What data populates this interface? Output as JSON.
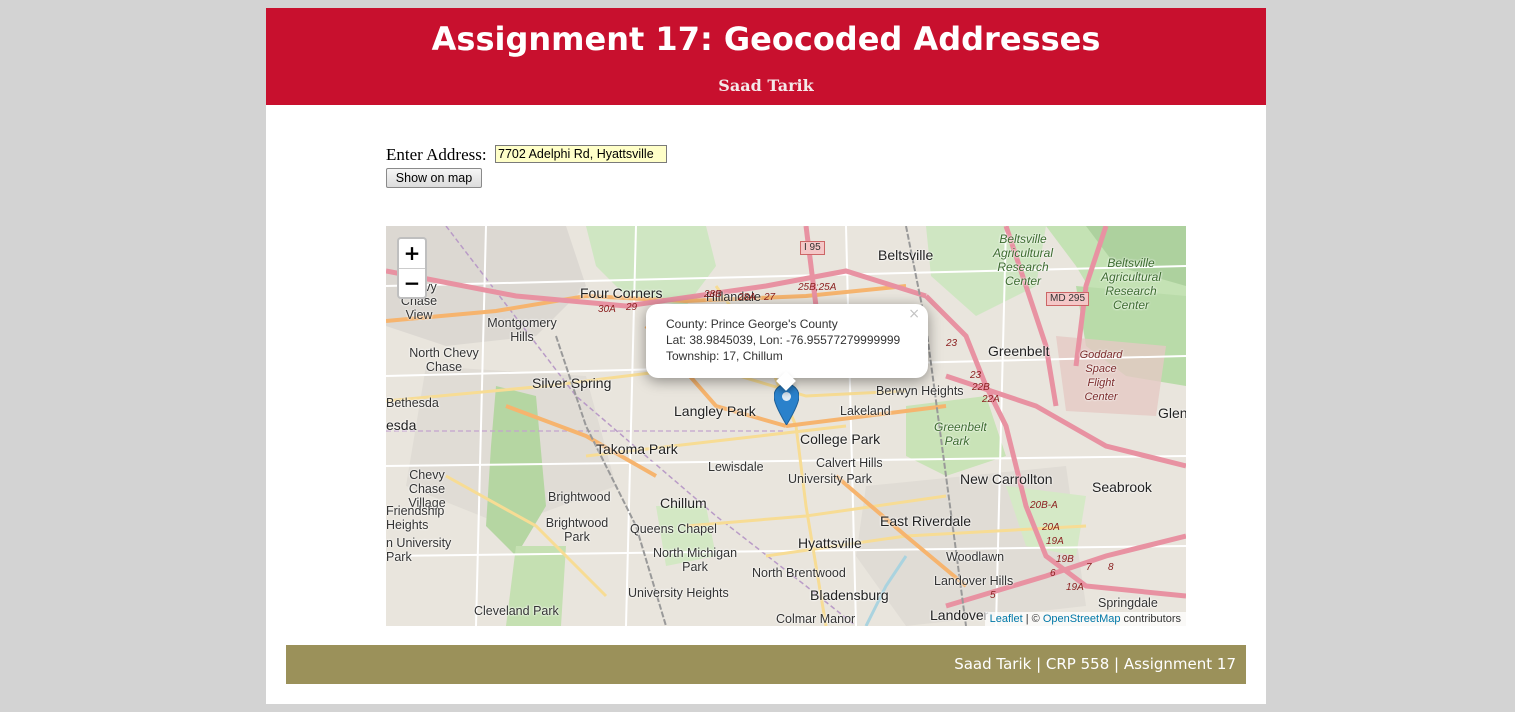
{
  "header": {
    "title": "Assignment 17: Geocoded Addresses",
    "author": "Saad Tarik"
  },
  "form": {
    "label": "Enter Address:",
    "address_value": "7702 Adelphi Rd, Hyattsville",
    "button_label": "Show on map"
  },
  "map": {
    "zoom_in": "+",
    "zoom_out": "−",
    "popup": {
      "line1": "County: Prince George's County",
      "line2": "Lat: 38.9845039, Lon: -76.95577279999999",
      "line3": "Township: 17, Chillum",
      "close": "×"
    },
    "attribution": {
      "leaflet": "Leaflet",
      "sep": " | © ",
      "osm": "OpenStreetMap",
      "suffix": " contributors"
    },
    "places": {
      "four_corners": "Four Corners",
      "hillandale": "Hillandale",
      "beltsville": "Beltsville",
      "beltsville_center": "Beltsville Agricultural Research Center",
      "beltsville_center2": "Beltsville Agricultural Research Center",
      "montgomery_hills": "Montgomery Hills",
      "north_chevy_chase": "North Chevy Chase",
      "silver_spring": "Silver Spring",
      "bethesda": "Bethesda",
      "esda": "esda",
      "langley_park": "Langley Park",
      "lakeland": "Lakeland",
      "berwyn_heights": "Berwyn Heights",
      "greenbelt": "Greenbelt",
      "goddard": "Goddard Space Flight Center",
      "glenn": "Glenn",
      "college_park": "College Park",
      "takoma_park": "Takoma Park",
      "calvert_hills": "Calvert Hills",
      "lewisdale": "Lewisdale",
      "university_park": "University Park",
      "greenbelt_park": "Greenbelt Park",
      "new_carrollton": "New Carrollton",
      "seabrook": "Seabrook",
      "chevy_chase_village": "Chevy Chase Village",
      "brightwood": "Brightwood",
      "chillum": "Chillum",
      "east_riverdale": "East Riverdale",
      "friendship_heights": "Friendship Heights",
      "brightwood_park": "Brightwood Park",
      "queens_chapel": "Queens Chapel",
      "american_university_park": "n University Park",
      "hyattsville": "Hyattsville",
      "woodlawn": "Woodlawn",
      "north_michigan_park": "North Michigan Park",
      "north_brentwood": "North Brentwood",
      "landover_hills": "Landover Hills",
      "university_heights": "University Heights",
      "bladensburg": "Bladensburg",
      "springdale": "Springdale",
      "cleveland_park": "Cleveland Park",
      "colmar_manor": "Colmar Manor",
      "landover": "Landover",
      "chevy_chase_view": "Chevy Chase View"
    },
    "shields": {
      "i95": "I 95",
      "md295": "MD 295"
    },
    "exits": {
      "e28b": "28B",
      "e28a": "28A",
      "e27": "27",
      "e25b": "25B;25A",
      "e30a": "30A",
      "e29": "29",
      "e23a": "23",
      "e23b": "23",
      "e22b": "22B",
      "e22a": "22A",
      "e20b": "20B-A",
      "e20a": "20A",
      "e19a": "19A",
      "e19b": "19B",
      "e7": "7",
      "e8": "8",
      "e6": "6",
      "e5": "5",
      "e19a2": "19A"
    }
  },
  "footer": {
    "text": "Saad Tarik | CRP 558 | Assignment 17"
  },
  "colors": {
    "header_bg": "#c8102e",
    "footer_bg": "#9b915a",
    "marker": "#2a81cb"
  }
}
